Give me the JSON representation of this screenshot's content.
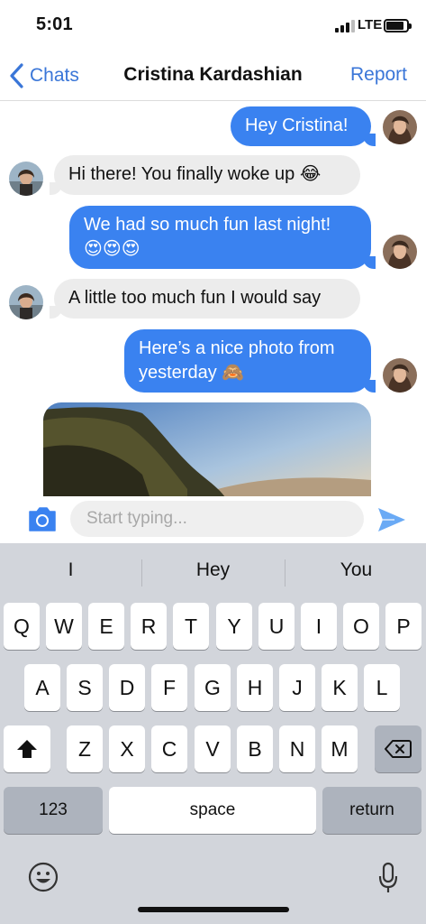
{
  "status_bar": {
    "time": "5:01",
    "network": "LTE",
    "signal_bars_active": 3,
    "signal_bars_total": 4
  },
  "nav": {
    "back_label": "Chats",
    "title": "Cristina Kardashian",
    "action_label": "Report"
  },
  "messages": [
    {
      "direction": "outgoing",
      "text": "Hey Cristina!"
    },
    {
      "direction": "incoming",
      "text": "Hi there! You finally woke up 😂"
    },
    {
      "direction": "outgoing",
      "text": "We had so much fun last night!",
      "text_line2": "😍😍😍"
    },
    {
      "direction": "incoming",
      "text": "A little too much fun I would say"
    },
    {
      "direction": "outgoing",
      "text": "Here’s a nice photo from",
      "text_line2": "yesterday 🙈"
    },
    {
      "direction": "incoming",
      "type": "photo"
    }
  ],
  "input": {
    "placeholder": "Start typing..."
  },
  "keyboard": {
    "suggestions": [
      "I",
      "Hey",
      "You"
    ],
    "row1": [
      "Q",
      "W",
      "E",
      "R",
      "T",
      "Y",
      "U",
      "I",
      "O",
      "P"
    ],
    "row2": [
      "A",
      "S",
      "D",
      "F",
      "G",
      "H",
      "J",
      "K",
      "L"
    ],
    "row3": [
      "Z",
      "X",
      "C",
      "V",
      "B",
      "N",
      "M"
    ],
    "numbers_label": "123",
    "space_label": "space",
    "return_label": "return"
  },
  "colors": {
    "accent": "#3a76d8",
    "outgoing_bubble": "#3a82f0",
    "incoming_bubble": "#ececec",
    "keyboard_bg": "#d2d5db"
  }
}
